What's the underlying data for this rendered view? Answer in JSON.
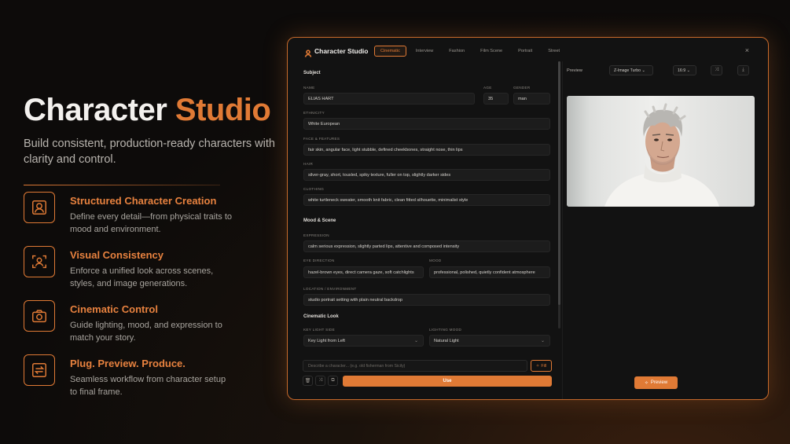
{
  "hero": {
    "title_main": "Character",
    "title_accent": "Studio",
    "subtitle": "Build consistent, production-ready characters with clarity and control."
  },
  "features": [
    {
      "title": "Structured Character Creation",
      "desc": "Define every detail—from physical traits to mood and environment.",
      "icon": "person-icon"
    },
    {
      "title": "Visual Consistency",
      "desc": "Enforce a unified look across scenes, styles, and image generations.",
      "icon": "face-scan-icon"
    },
    {
      "title": "Cinematic Control",
      "desc": "Guide lighting, mood, and expression to match your story.",
      "icon": "camera-icon"
    },
    {
      "title": "Plug. Preview. Produce.",
      "desc": "Seamless workflow from character setup to final frame.",
      "icon": "swap-arrows-icon"
    }
  ],
  "app": {
    "title": "Character Studio",
    "tabs": [
      "Cinematic",
      "Interview",
      "Fashion",
      "Film Scene",
      "Portrait",
      "Street"
    ],
    "active_tab": "Cinematic",
    "close": "×",
    "subject": {
      "section": "Subject",
      "name_label": "NAME",
      "name": "ELIAS HART",
      "age_label": "AGE",
      "age": "35",
      "gender_label": "GENDER",
      "gender": "man",
      "ethnicity_label": "ETHNICITY",
      "ethnicity": "White European",
      "face_label": "FACE & FEATURES",
      "face": "fair skin, angular face, light stubble, defined cheekbones, straight nose, thin lips",
      "hair_label": "HAIR",
      "hair": "silver-gray, short, tousled, spiky texture, fuller on top, slightly darker sides",
      "clothing_label": "CLOTHING",
      "clothing": "white turtleneck sweater, smooth knit fabric, clean fitted silhouette, minimalist style"
    },
    "mood_scene": {
      "section": "Mood & Scene",
      "expression_label": "EXPRESSION",
      "expression": "calm serious expression, slightly parted lips, attentive and composed intensity",
      "eye_label": "EYE DIRECTION",
      "eye": "hazel-brown eyes, direct camera gaze, soft catchlights",
      "mood_label": "MOOD",
      "mood": "professional, polished, quietly confident atmosphere",
      "location_label": "LOCATION / ENVIRONMENT",
      "location": "studio portrait setting with plain neutral backdrop"
    },
    "cinematic": {
      "section": "Cinematic Look",
      "key_light_label": "KEY LIGHT SIDE",
      "key_light": "Key Light from Left",
      "lighting_mood_label": "LIGHTING MOOD",
      "lighting_mood": "Natural Light"
    },
    "prompt_placeholder": "Describe a character... (e.g. old fisherman from Sicily)",
    "fill_label": "Fill",
    "use_label": "Use",
    "preview": {
      "label": "Preview",
      "model": "Z-Image Turbo",
      "aspect": "16:9",
      "run_label": "Preview"
    }
  },
  "colors": {
    "accent": "#e07a35",
    "bg": "#121212"
  }
}
